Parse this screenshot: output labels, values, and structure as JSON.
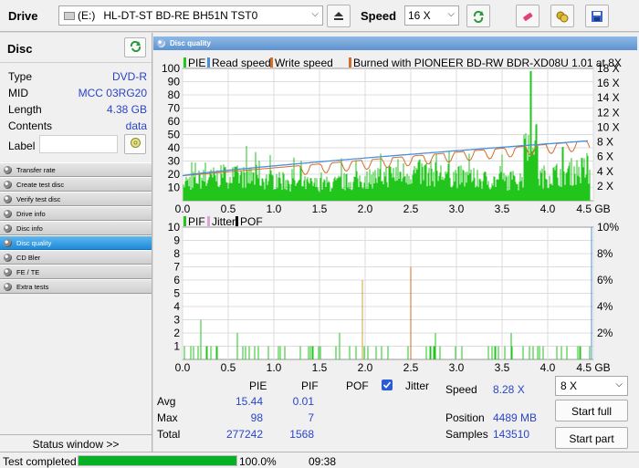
{
  "toolbar": {
    "drive_label": "Drive",
    "drive_letter": "(E:)",
    "drive_name": "HL-DT-ST BD-RE  BH51N TST0",
    "speed_label": "Speed",
    "speed_value": "16 X"
  },
  "disc": {
    "title": "Disc",
    "rows": [
      {
        "key": "Type",
        "value": "DVD-R"
      },
      {
        "key": "MID",
        "value": "MCC 03RG20"
      },
      {
        "key": "Length",
        "value": "4.38 GB"
      },
      {
        "key": "Contents",
        "value": "data"
      }
    ],
    "label_key": "Label",
    "label_value": ""
  },
  "menu": [
    {
      "label": "Transfer rate",
      "active": false
    },
    {
      "label": "Create test disc",
      "active": false
    },
    {
      "label": "Verify test disc",
      "active": false
    },
    {
      "label": "Drive info",
      "active": false
    },
    {
      "label": "Disc info",
      "active": false
    },
    {
      "label": "Disc quality",
      "active": true
    },
    {
      "label": "CD Bler",
      "active": false
    },
    {
      "label": "FE / TE",
      "active": false
    },
    {
      "label": "Extra tests",
      "active": false
    }
  ],
  "status_window_label": "Status window >>",
  "panel_title": "Disc quality",
  "chart_data": [
    {
      "type": "bar",
      "legend": [
        "PIE",
        "Read speed",
        "Write speed",
        "Burned with PIONEER BD-RW  BDR-XD08U 1.01 at 8X"
      ],
      "x_ticks": [
        "0.0",
        "0.5",
        "1.0",
        "1.5",
        "2.0",
        "2.5",
        "3.0",
        "3.5",
        "4.0",
        "4.5 GB"
      ],
      "y_ticks_left": [
        "100",
        "90",
        "80",
        "70",
        "60",
        "50",
        "40",
        "30",
        "20",
        "10"
      ],
      "y_ticks_right": [
        "18 X",
        "16 X",
        "14 X",
        "12 X",
        "10 X",
        "8 X",
        "6 X",
        "4 X",
        "2 X"
      ],
      "xlim": [
        0,
        4.5
      ],
      "ylim": [
        0,
        100
      ],
      "y2lim": [
        0,
        18
      ],
      "pie_avg": 15.44,
      "pie_max": 98,
      "pie_spike_at_gb": 3.82,
      "read_speed_start_x": 3.4,
      "read_speed_end_x": 8.2,
      "write_speed_target_x": 8,
      "colors": {
        "pie": "#22c51c",
        "read_speed": "#4a8fdc",
        "write_speed": "#d36d2c",
        "burned": "#d36d2c"
      },
      "grid": true
    },
    {
      "type": "bar",
      "legend": [
        "PIF",
        "Jitter",
        "POF"
      ],
      "x_ticks": [
        "0.0",
        "0.5",
        "1.0",
        "1.5",
        "2.0",
        "2.5",
        "3.0",
        "3.5",
        "4.0",
        "4.5 GB"
      ],
      "y_ticks_left": [
        "10",
        "9",
        "8",
        "7",
        "6",
        "5",
        "4",
        "3",
        "2",
        "1"
      ],
      "y_ticks_right": [
        "10%",
        "8%",
        "6%",
        "4%",
        "2%"
      ],
      "xlim": [
        0,
        4.5
      ],
      "ylim": [
        0,
        10
      ],
      "y2lim": [
        0,
        10
      ],
      "pif_max": 7,
      "pif_max_at_gb": 2.5,
      "notable_bars": [
        {
          "x": 0.2,
          "y": 3
        },
        {
          "x": 0.6,
          "y": 2
        },
        {
          "x": 1.72,
          "y": 2
        },
        {
          "x": 1.97,
          "y": 6
        },
        {
          "x": 2.5,
          "y": 7
        },
        {
          "x": 2.77,
          "y": 2
        },
        {
          "x": 3.6,
          "y": 2
        }
      ],
      "colors": {
        "pif": "#22c51c",
        "pif_max": "#d36d2c",
        "pof": "#000000",
        "jitter": "#e0a0d8"
      },
      "grid": true
    }
  ],
  "stats": {
    "col_pie": "PIE",
    "col_pif": "PIF",
    "col_pof": "POF",
    "jitter_label": "Jitter",
    "jitter_checked": true,
    "rows": [
      {
        "label": "Avg",
        "pie": "15.44",
        "pif": "0.01"
      },
      {
        "label": "Max",
        "pie": "98",
        "pif": "7"
      },
      {
        "label": "Total",
        "pie": "277242",
        "pif": "1568"
      }
    ],
    "speed_label": "Speed",
    "speed_value": "8.28 X",
    "position_label": "Position",
    "position_value": "4489 MB",
    "samples_label": "Samples",
    "samples_value": "143510",
    "speed_select": "8 X",
    "start_full": "Start full",
    "start_part": "Start part"
  },
  "statusbar": {
    "text": "Test completed",
    "progress_fraction": 1.0,
    "progress_text": "100.0%",
    "elapsed": "09:38"
  }
}
